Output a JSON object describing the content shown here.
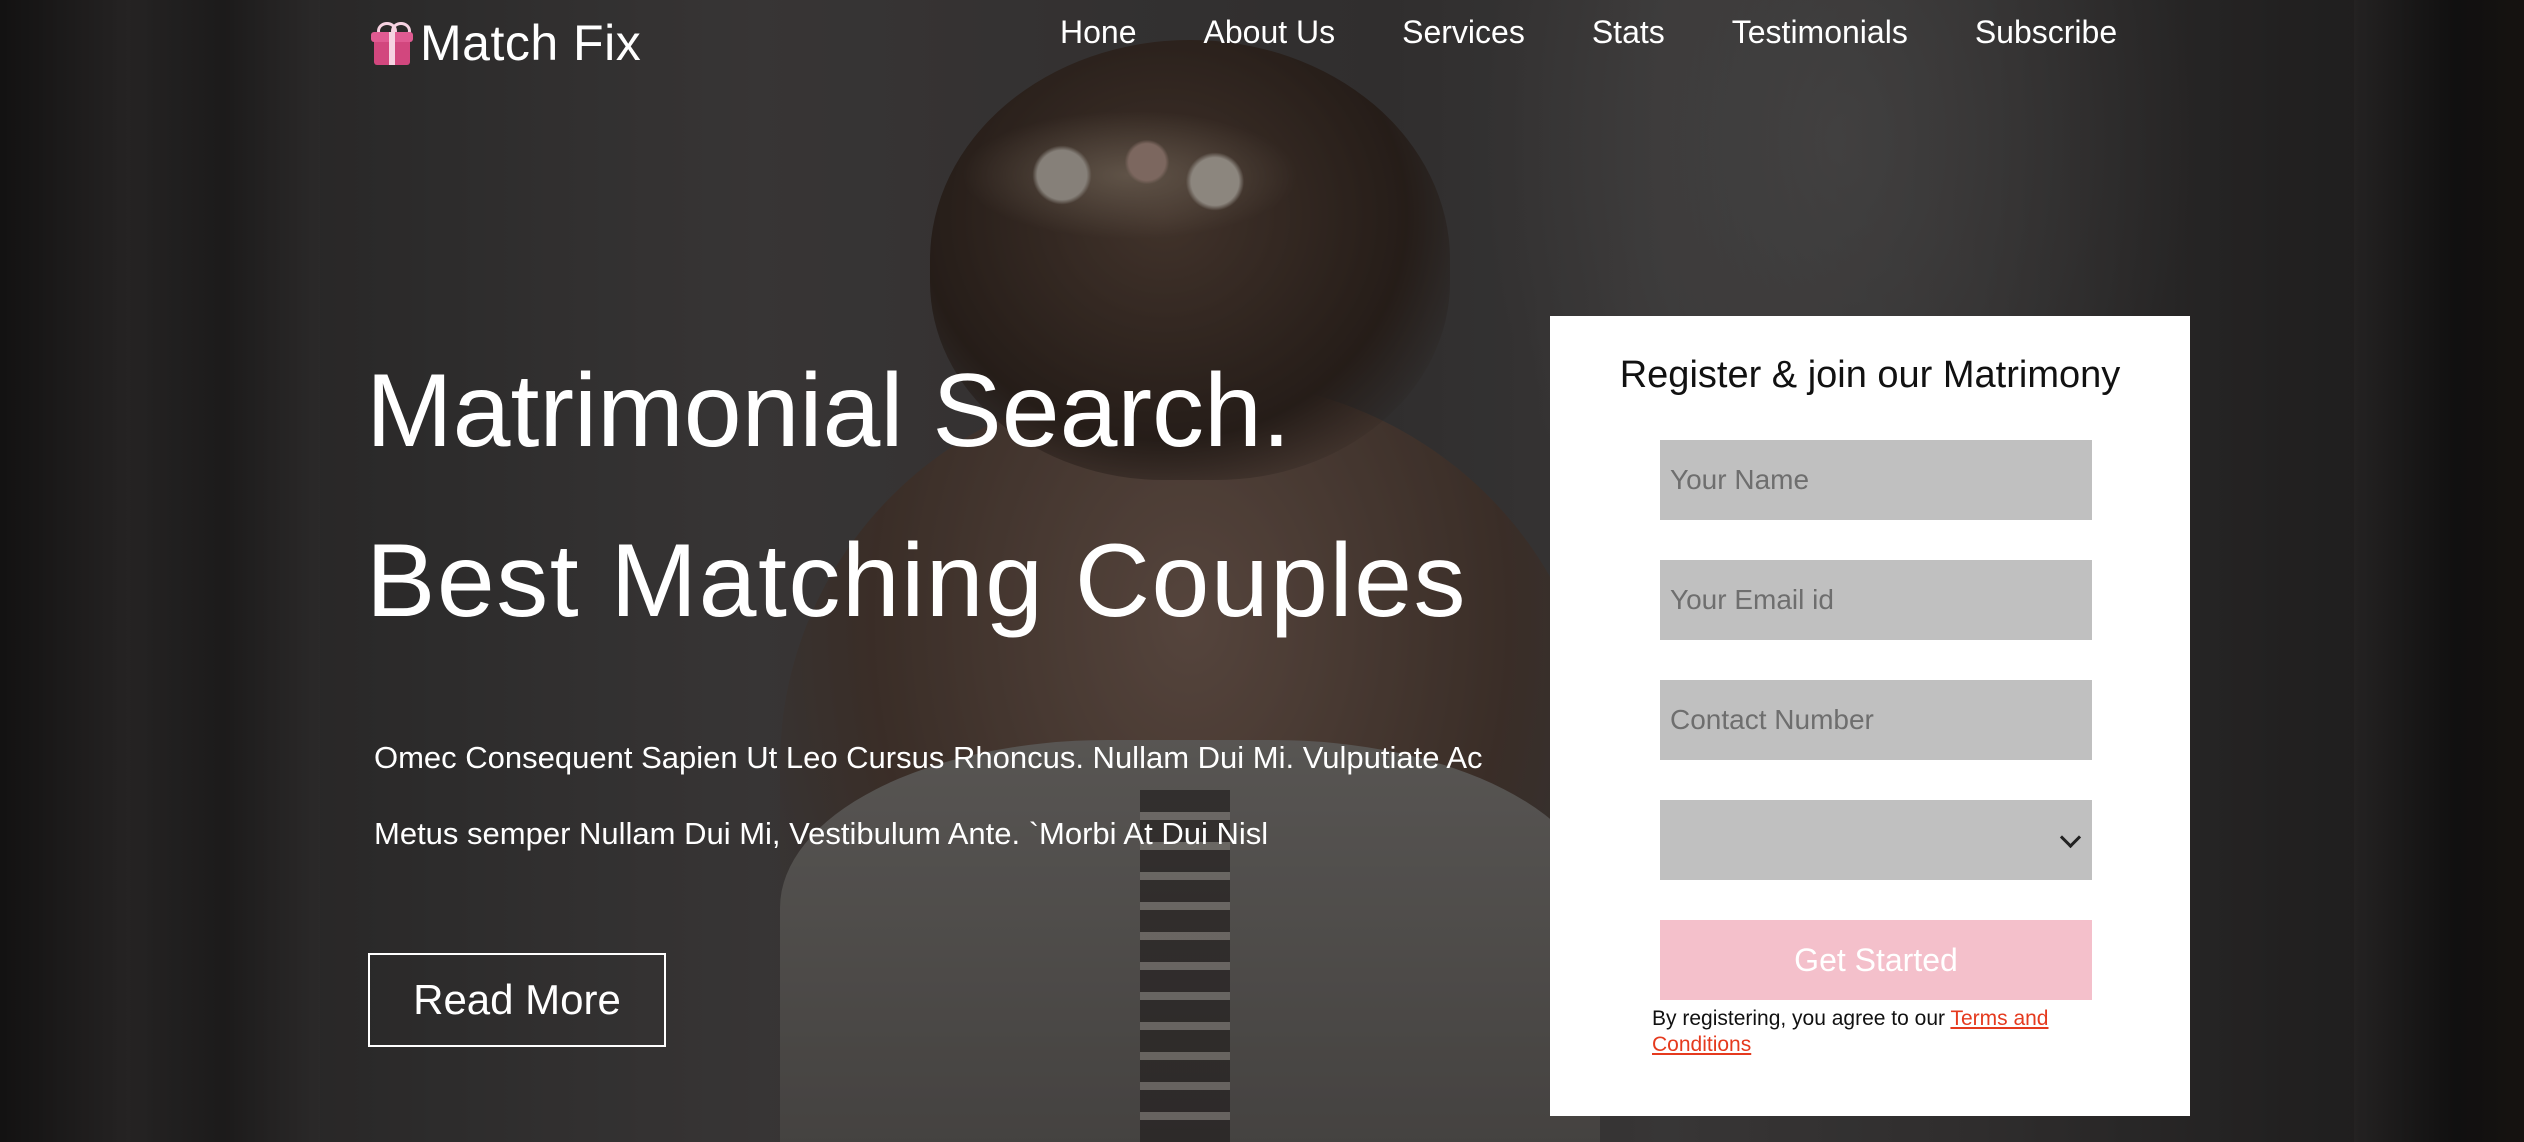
{
  "brand": {
    "name": "Match Fix",
    "icon": "gift-icon"
  },
  "nav": {
    "items": [
      {
        "label": "Hone"
      },
      {
        "label": "About Us"
      },
      {
        "label": "Services"
      },
      {
        "label": "Stats"
      },
      {
        "label": "Testimonials"
      },
      {
        "label": "Subscribe"
      }
    ]
  },
  "hero": {
    "title_line1": "Matrimonial Search.",
    "title_line2": "Best Matching Couples",
    "body_line1": "Omec Consequent Sapien Ut Leo Cursus Rhoncus. Nullam Dui Mi. Vulputiate Ac",
    "body_line2": "Metus semper Nullam Dui Mi, Vestibulum Ante. `Morbi At Dui Nisl",
    "read_more_label": "Read More"
  },
  "register": {
    "title": "Register & join our Matrimony",
    "name_placeholder": "Your Name",
    "email_placeholder": "Your Email id",
    "contact_placeholder": "Contact Number",
    "select_value": "",
    "submit_label": "Get Started",
    "terms_prefix": "By registering, you agree to our ",
    "terms_link": "Terms and Conditions"
  },
  "colors": {
    "submit_bg": "#f4c0cb",
    "field_bg": "#c0c0c0",
    "terms_link": "#e53a1e",
    "brand_icon": "#d2477e"
  }
}
